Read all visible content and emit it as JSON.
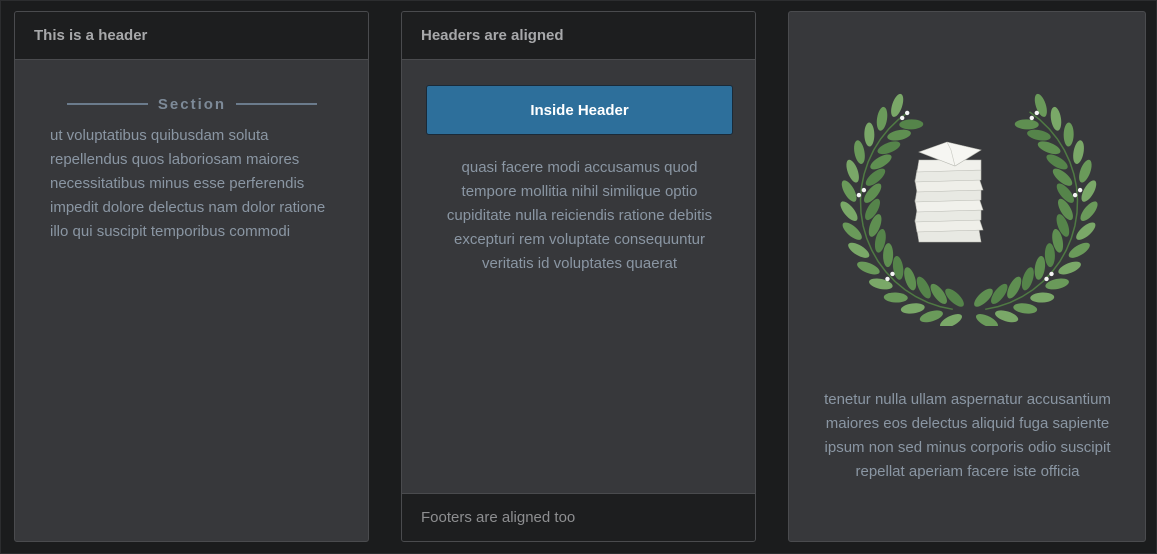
{
  "cards": [
    {
      "header": "This is a header",
      "section_label": "Section",
      "body": "ut voluptatibus quibusdam soluta repellendus quos laboriosam maiores necessitatibus minus esse perferendis impedit dolore delectus nam dolor ratione illo qui suscipit temporibus commodi"
    },
    {
      "header": "Headers are aligned",
      "button_label": "Inside Header",
      "body": "quasi facere modi accusamus quod tempore mollitia nihil similique optio cupiditate nulla reiciendis ratione debitis excepturi rem voluptate consequuntur veritatis id voluptates quaerat",
      "footer": "Footers are aligned too"
    },
    {
      "image": "laurel-wreath-paper-stack",
      "body": "tenetur nulla ullam aspernatur accusantium maiores eos delectus aliquid fuga sapiente ipsum non sed minus corporis odio suscipit repellat aperiam facere iste officia"
    }
  ],
  "colors": {
    "page_bg": "#1b1c1d",
    "card_bg": "#37383b",
    "header_bg": "#1d1e1f",
    "button_bg": "#2d6f9b",
    "body_text": "#8a96a3",
    "leaf_green": "#6a9a5a"
  }
}
